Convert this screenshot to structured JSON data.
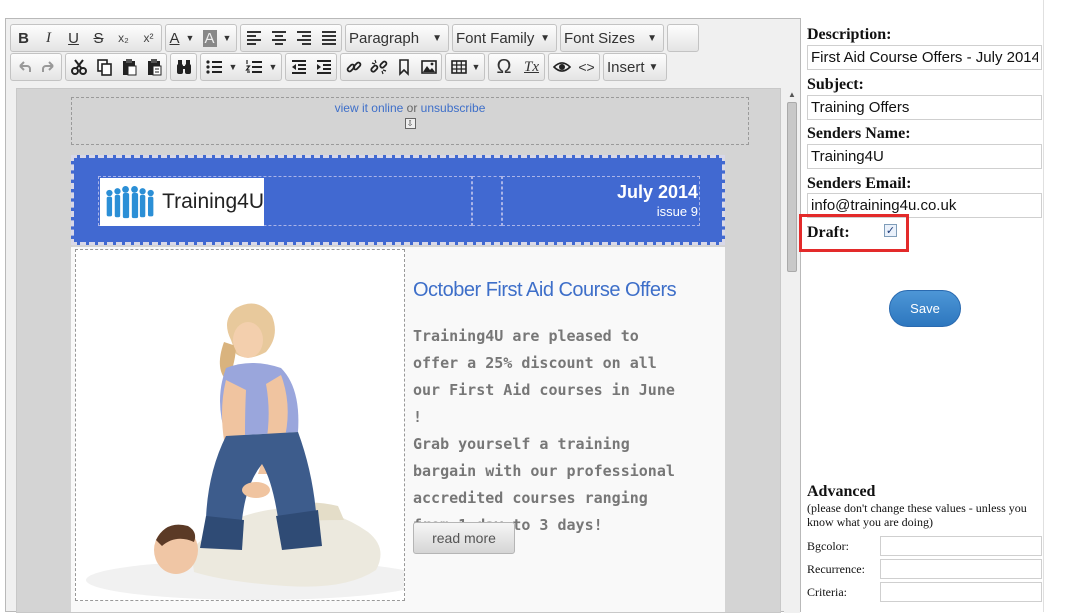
{
  "toolbar": {
    "bold": "B",
    "italic": "I",
    "underline": "U",
    "strike": "S",
    "subscript": "x₂",
    "superscript": "x²",
    "font_color": "A",
    "bg_color": "A",
    "paragraph": "Paragraph",
    "font_family": "Font Family",
    "font_sizes": "Font Sizes",
    "omega": "Ω",
    "clear_format": "Tx",
    "code": "<>",
    "insert": "Insert"
  },
  "newsletter": {
    "view_online": "view it online",
    "or": "or",
    "unsubscribe": "unsubscribe",
    "brand": "Training4U",
    "month": "July 2014",
    "issue": "issue 9",
    "offer_title": "October First Aid Course Offers",
    "offer_body_1": "Training4U are pleased to offer a 25% discount on all our First Aid courses in June !",
    "offer_body_2": "Grab yourself a training bargain with our professional accredited courses ranging from 1 day to 3 days!",
    "read_more": "read more"
  },
  "form": {
    "description_label": "Description:",
    "description_value": "First Aid Course Offers - July 2014",
    "subject_label": "Subject:",
    "subject_value": "Training Offers",
    "senders_name_label": "Senders Name:",
    "senders_name_value": "Training4U",
    "senders_email_label": "Senders Email:",
    "senders_email_value": "info@training4u.co.uk",
    "draft_label": "Draft:",
    "draft_checked": true,
    "save_label": "Save"
  },
  "advanced": {
    "title": "Advanced",
    "note": "(please don't change these values - unless you know what you are doing)",
    "bgcolor_label": "Bgcolor:",
    "bgcolor_value": "",
    "recurrence_label": "Recurrence:",
    "recurrence_value": "",
    "criteria_label": "Criteria:",
    "criteria_value": ""
  },
  "colors": {
    "header_blue": "#4169d1",
    "link_blue": "#3e6fc9",
    "highlight_red": "#e32a2a",
    "save_blue": "#2d77bf"
  }
}
